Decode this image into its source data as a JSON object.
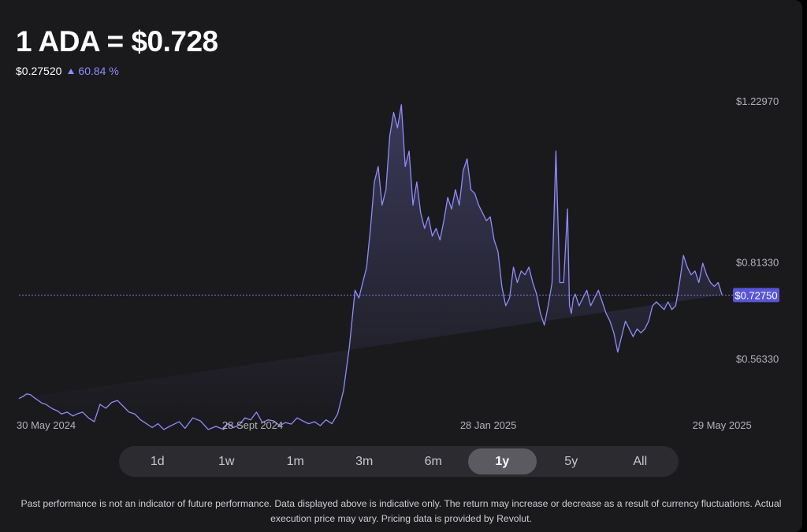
{
  "header": {
    "title": "1 ADA = $0.728",
    "change_amount": "$0.27520",
    "change_percent": "60.84 %"
  },
  "range_selector": {
    "options": [
      "1d",
      "1w",
      "1m",
      "3m",
      "6m",
      "1y",
      "5y",
      "All"
    ],
    "selected": "1y"
  },
  "disclaimer": "Past performance is not an indicator of future performance. Data displayed above is indicative only. The return may increase or decrease as a result of currency fluctuations. Actual execution price may vary. Pricing data is provided by Revolut.",
  "colors": {
    "line": "#8e8dfb",
    "badge": "#5856d6",
    "background": "#1a191c"
  },
  "chart_data": {
    "type": "area",
    "x_ticks": [
      "30 May 2024",
      "28 Sept 2024",
      "28 Jan 2025",
      "29 May 2025"
    ],
    "x_tick_days": [
      0,
      121,
      243,
      364
    ],
    "y_ticks": [
      "$1.22970",
      "$0.81330",
      "$0.56330"
    ],
    "y_tick_values": [
      1.2297,
      0.8133,
      0.5633
    ],
    "current_value": 0.7275,
    "current_label": "$0.72750",
    "x": [
      0,
      2,
      4,
      6,
      8,
      10,
      12,
      14,
      16,
      18,
      20,
      22,
      25,
      28,
      30,
      33,
      36,
      39,
      42,
      45,
      48,
      51,
      54,
      57,
      60,
      63,
      66,
      69,
      72,
      75,
      78,
      80,
      83,
      86,
      90,
      94,
      98,
      102,
      106,
      108,
      111,
      114,
      117,
      120,
      123,
      126,
      129,
      132,
      135,
      138,
      141,
      144,
      147,
      150,
      153,
      156,
      159,
      162,
      165,
      168,
      171,
      172,
      174,
      176,
      178,
      180,
      182,
      184,
      186,
      188,
      190,
      192,
      194,
      196,
      198,
      200,
      202,
      204,
      206,
      208,
      210,
      212,
      214,
      216,
      218,
      220,
      222,
      224,
      226,
      228,
      230,
      232,
      234,
      236,
      238,
      240,
      242,
      244,
      246,
      248,
      250,
      252,
      254,
      256,
      258,
      260,
      262,
      264,
      266,
      268,
      270,
      272,
      274,
      276,
      278,
      280,
      282,
      284,
      285,
      286,
      287,
      288,
      290,
      292,
      294,
      296,
      298,
      300,
      302,
      304,
      306,
      308,
      310,
      312,
      314,
      316,
      318,
      320,
      322,
      324,
      326,
      328,
      330,
      332,
      334,
      336,
      338,
      340,
      342,
      344,
      346,
      348,
      350,
      352,
      354,
      356,
      358,
      360,
      362,
      364,
      366,
      368
    ],
    "values": [
      0.46,
      0.465,
      0.472,
      0.47,
      0.462,
      0.455,
      0.448,
      0.445,
      0.438,
      0.432,
      0.428,
      0.42,
      0.425,
      0.415,
      0.42,
      0.425,
      0.41,
      0.4,
      0.445,
      0.435,
      0.45,
      0.455,
      0.44,
      0.425,
      0.42,
      0.405,
      0.395,
      0.385,
      0.395,
      0.38,
      0.388,
      0.393,
      0.4,
      0.383,
      0.41,
      0.402,
      0.38,
      0.388,
      0.38,
      0.395,
      0.385,
      0.392,
      0.41,
      0.405,
      0.425,
      0.398,
      0.405,
      0.402,
      0.39,
      0.398,
      0.394,
      0.41,
      0.402,
      0.395,
      0.4,
      0.39,
      0.405,
      0.395,
      0.42,
      0.48,
      0.59,
      0.64,
      0.74,
      0.72,
      0.76,
      0.8,
      0.9,
      1.02,
      1.06,
      0.96,
      1.0,
      1.14,
      1.2,
      1.16,
      1.22,
      1.06,
      1.1,
      0.96,
      1.02,
      0.94,
      0.9,
      0.93,
      0.88,
      0.9,
      0.87,
      0.92,
      0.98,
      0.95,
      1.0,
      0.96,
      1.05,
      1.08,
      1.0,
      0.99,
      0.96,
      0.94,
      0.92,
      0.93,
      0.87,
      0.84,
      0.75,
      0.7,
      0.72,
      0.8,
      0.76,
      0.79,
      0.78,
      0.8,
      0.76,
      0.73,
      0.68,
      0.65,
      0.7,
      0.76,
      1.1,
      0.76,
      0.76,
      0.95,
      0.7,
      0.68,
      0.72,
      0.73,
      0.7,
      0.72,
      0.74,
      0.7,
      0.72,
      0.74,
      0.71,
      0.68,
      0.66,
      0.63,
      0.58,
      0.62,
      0.66,
      0.64,
      0.62,
      0.64,
      0.63,
      0.64,
      0.66,
      0.7,
      0.71,
      0.7,
      0.69,
      0.71,
      0.69,
      0.7,
      0.76,
      0.83,
      0.8,
      0.78,
      0.79,
      0.76,
      0.81,
      0.78,
      0.76,
      0.75,
      0.76,
      0.728
    ]
  }
}
